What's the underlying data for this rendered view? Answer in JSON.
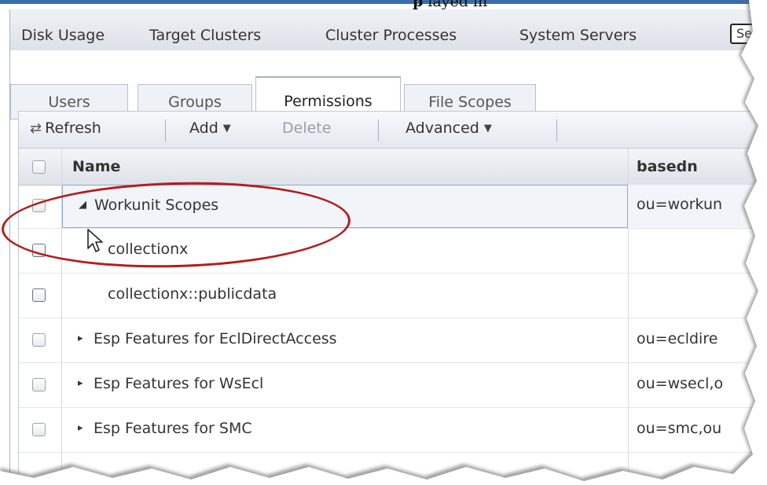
{
  "caption": {
    "bold": "p",
    "tail": "layed in"
  },
  "topnav": {
    "items": [
      "Disk Usage",
      "Target Clusters",
      "Cluster Processes",
      "System Servers"
    ],
    "search_value": "Se"
  },
  "tabs": [
    {
      "label": "Users",
      "active": false
    },
    {
      "label": "Groups",
      "active": false
    },
    {
      "label": "Permissions",
      "active": true
    },
    {
      "label": "File Scopes",
      "active": false
    }
  ],
  "toolbar": {
    "refresh": "Refresh",
    "add": "Add",
    "delete": "Delete",
    "advanced": "Advanced"
  },
  "grid": {
    "headers": {
      "name": "Name",
      "basedn": "basedn"
    },
    "rows": [
      {
        "name": "Workunit Scopes",
        "basedn": "ou=workun",
        "expander": "◢",
        "indent": 0,
        "selected": true
      },
      {
        "name": "collectionx",
        "basedn": "",
        "expander": "",
        "indent": 1,
        "selected": false
      },
      {
        "name": "collectionx::publicdata",
        "basedn": "",
        "expander": "",
        "indent": 1,
        "selected": false
      },
      {
        "name": "Esp Features for EclDirectAccess",
        "basedn": "ou=ecldire",
        "expander": "▸",
        "indent": 0,
        "selected": false
      },
      {
        "name": "Esp Features for WsEcl",
        "basedn": "ou=wsecl,o",
        "expander": "▸",
        "indent": 0,
        "selected": false
      },
      {
        "name": "Esp Features for SMC",
        "basedn": "ou=smc,ou",
        "expander": "▸",
        "indent": 0,
        "selected": false
      }
    ]
  },
  "colors": {
    "annotation": "#b51c1c",
    "tab_border": "#b7bfca",
    "selection_border": "#8aaad0"
  }
}
